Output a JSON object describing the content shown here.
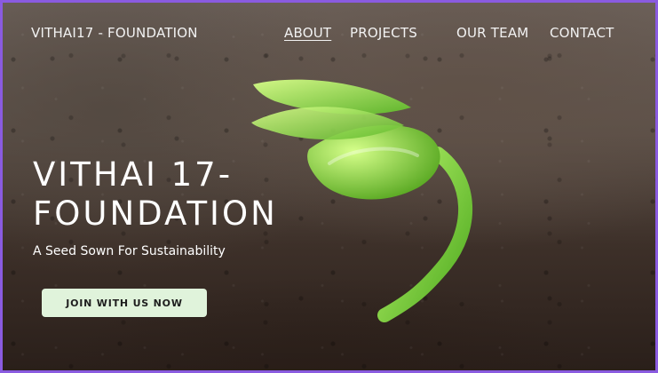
{
  "header": {
    "brand": "VITHAI17 - FOUNDATION",
    "nav": {
      "about": "ABOUT",
      "projects": "PROJECTS",
      "our_team": "OUR TEAM",
      "contact": "CONTACT"
    }
  },
  "hero": {
    "title_line_1": "VITHAI 17-",
    "title_line_2": "FOUNDATION",
    "subtitle": "A Seed Sown For Sustainability",
    "cta_label": "JOIN WITH US NOW"
  },
  "theme": {
    "border": "#8a5be0",
    "text": "#ffffff",
    "cta_bg": "#e0f3db",
    "sprout_green": "#7ecb2f"
  }
}
